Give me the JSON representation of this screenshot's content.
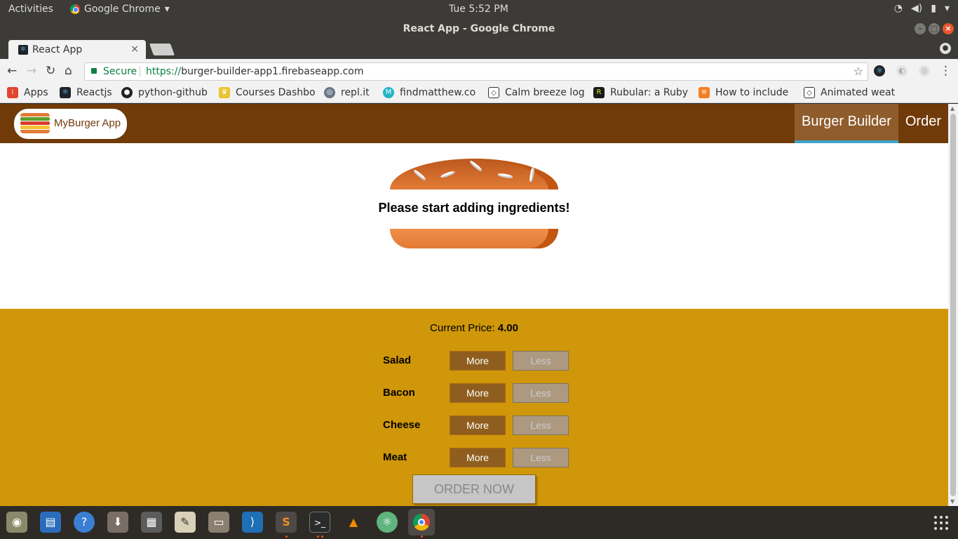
{
  "topbar": {
    "activities": "Activities",
    "app_name": "Google Chrome",
    "clock": "Tue  5:52 PM"
  },
  "window": {
    "title": "React App - Google Chrome"
  },
  "tab": {
    "label": "React App",
    "close": "×"
  },
  "omnibox": {
    "secure_label": "Secure",
    "url_scheme": "https://",
    "url_rest": "burger-builder-app1.firebaseapp.com"
  },
  "bookmarks": [
    {
      "label": "Apps",
      "icon": "apps-grid-icon",
      "color": "#e0462f"
    },
    {
      "label": "Reactjs",
      "icon": "react-icon",
      "color": "#20232a"
    },
    {
      "label": "python-github",
      "icon": "github-icon",
      "color": "#222222"
    },
    {
      "label": "Courses Dashbo",
      "icon": "crown-icon",
      "color": "#e9c534"
    },
    {
      "label": "repl.it",
      "icon": "replit-icon",
      "color": "#667788"
    },
    {
      "label": "findmatthew.co",
      "icon": "findmatthew-icon",
      "color": "#22b5c6"
    },
    {
      "label": "Calm breeze log",
      "icon": "codepen-icon",
      "color": "#333333"
    },
    {
      "label": "Rubular: a Ruby",
      "icon": "rubular-icon",
      "color": "#1a1a1a"
    },
    {
      "label": "How to include",
      "icon": "stackoverflow-icon",
      "color": "#f48024"
    },
    {
      "label": "Animated weat",
      "icon": "codepen-icon",
      "color": "#333333"
    }
  ],
  "app": {
    "logo_text": "MyBurger App",
    "nav": [
      {
        "label": "Burger Builder",
        "active": true
      },
      {
        "label": "Order",
        "active": false
      }
    ],
    "prompt": "Please start adding ingredients!",
    "price_label": "Current Price:",
    "price_value": "4.00",
    "ingredients": [
      {
        "label": "Salad",
        "more": "More",
        "less": "Less"
      },
      {
        "label": "Bacon",
        "more": "More",
        "less": "Less"
      },
      {
        "label": "Cheese",
        "more": "More",
        "less": "Less"
      },
      {
        "label": "Meat",
        "more": "More",
        "less": "Less"
      }
    ],
    "order_button": "ORDER NOW"
  },
  "colors": {
    "toolbar_brown": "#703b09",
    "active_nav": "#8f5c2c",
    "active_underline": "#40a4c8",
    "controls_bg": "#cf9709",
    "more_btn": "#8f5e1e",
    "less_btn": "#ac9980"
  },
  "dock": [
    {
      "name": "disk-icon",
      "glyph": "◉",
      "color": "#8a8a6a"
    },
    {
      "name": "writer-icon",
      "glyph": "▤",
      "color": "#2a6ebb"
    },
    {
      "name": "help-icon",
      "glyph": "?",
      "color": "#3b7fd4"
    },
    {
      "name": "installer-icon",
      "glyph": "⬇",
      "color": "#7a6f66"
    },
    {
      "name": "calculator-icon",
      "glyph": "▦",
      "color": "#5c5c5c"
    },
    {
      "name": "text-editor-icon",
      "glyph": "✎",
      "color": "#d9d0b8"
    },
    {
      "name": "files-icon",
      "glyph": "▭",
      "color": "#8a7f70"
    },
    {
      "name": "vscode-icon",
      "glyph": "⟩",
      "color": "#1f6fb5"
    },
    {
      "name": "sublime-icon",
      "glyph": "S",
      "color": "#f28e1c"
    },
    {
      "name": "terminal-icon",
      "glyph": ">_",
      "color": "#2b2b2b"
    },
    {
      "name": "vlc-icon",
      "glyph": "▲",
      "color": "#f08a00"
    },
    {
      "name": "atom-icon",
      "glyph": "⚛",
      "color": "#5fb57d"
    },
    {
      "name": "chrome-icon",
      "glyph": "●",
      "color": "#db4437"
    }
  ]
}
